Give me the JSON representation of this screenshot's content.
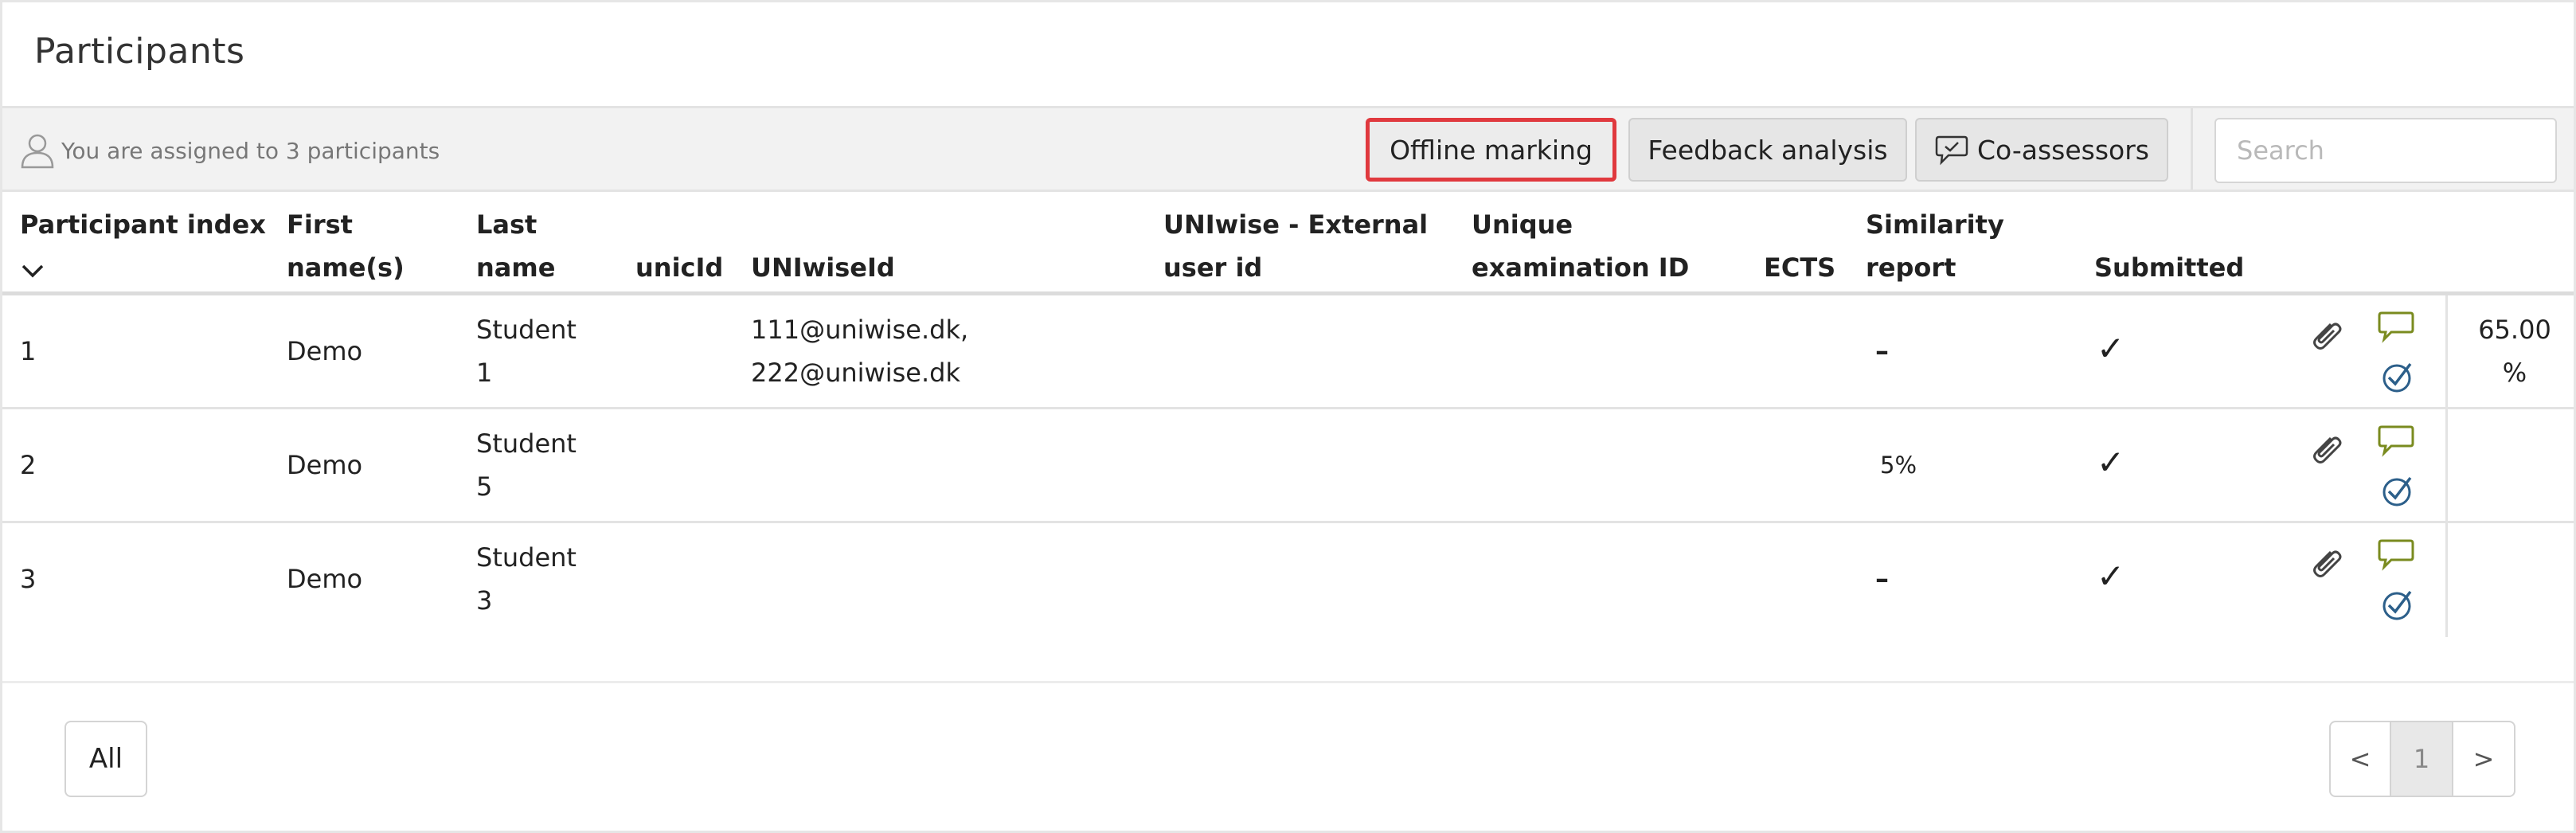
{
  "page": {
    "title": "Participants"
  },
  "toolbar": {
    "assigned_text": "You are assigned to 3 participants",
    "offline_marking": "Offline marking",
    "feedback_analysis": "Feedback analysis",
    "co_assessors": "Co-assessors",
    "search_placeholder": "Search",
    "search_value": ""
  },
  "table": {
    "headers": {
      "participant_index": "Participant index",
      "first_names_1": "First",
      "first_names_2": "name(s)",
      "last_name_1": "Last",
      "last_name_2": "name",
      "unicid": "unicId",
      "uniwiseid": "UNIwiseId",
      "external_1": "UNIwise - External",
      "external_2": "user id",
      "exam_1": "Unique",
      "exam_2": "examination ID",
      "ects": "ECTS",
      "similarity_1": "Similarity",
      "similarity_2": "report",
      "submitted": "Submitted"
    },
    "rows": [
      {
        "index": "1",
        "first": "Demo",
        "last_1": "Student",
        "last_2": "1",
        "uniwise_1": "111@uniwise.dk,",
        "uniwise_2": "222@uniwise.dk",
        "similarity": "–",
        "submitted": "✓",
        "score_1": "65.00",
        "score_2": "%"
      },
      {
        "index": "2",
        "first": "Demo",
        "last_1": "Student",
        "last_2": "5",
        "uniwise_1": "",
        "uniwise_2": "",
        "similarity": "5%",
        "submitted": "✓",
        "score_1": "",
        "score_2": ""
      },
      {
        "index": "3",
        "first": "Demo",
        "last_1": "Student",
        "last_2": "3",
        "uniwise_1": "",
        "uniwise_2": "",
        "similarity": "–",
        "submitted": "✓",
        "score_1": "",
        "score_2": ""
      }
    ]
  },
  "footer": {
    "all_button": "All",
    "pager_prev": "<",
    "pager_current": "1",
    "pager_next": ">"
  },
  "colors": {
    "highlight_border": "#e0393e",
    "comment_icon": "#7a8b1f",
    "assess_icon": "#2c5f8a",
    "toolbar_bg": "#f2f2f2"
  },
  "icons": {
    "user": "user-icon",
    "speech_bubble": "speech-bubble-icon",
    "sort": "chevron-down-icon",
    "attachment": "paperclip-icon",
    "comment": "comment-icon",
    "assess": "check-circle-icon"
  }
}
